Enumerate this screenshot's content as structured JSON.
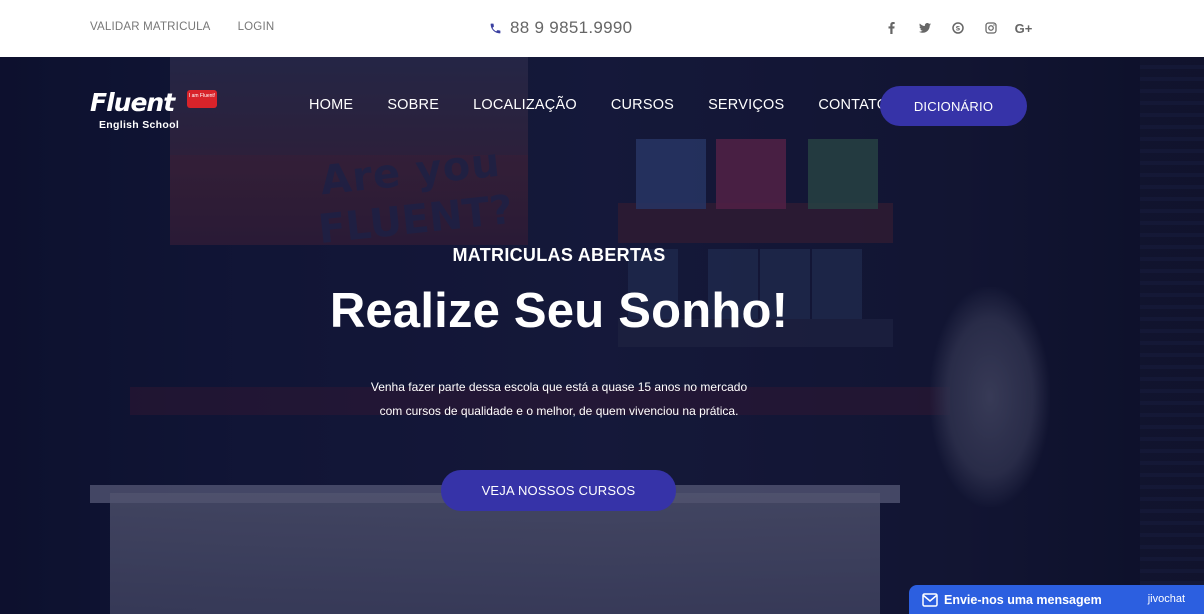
{
  "topbar": {
    "links": [
      "VALIDAR MATRICULA",
      "LOGIN"
    ],
    "phone": "88 9 9851.9990",
    "socials": [
      {
        "icon": "facebook-icon"
      },
      {
        "icon": "twitter-icon"
      },
      {
        "icon": "skype-icon"
      },
      {
        "icon": "instagram-icon"
      },
      {
        "icon": "google-plus-icon",
        "label": "G+"
      }
    ]
  },
  "logo": {
    "main": "Fluent",
    "tag": "I am Fluent!",
    "sub": "English School"
  },
  "nav": {
    "items": [
      "HOME",
      "SOBRE",
      "LOCALIZAÇÃO",
      "CURSOS",
      "SERVIÇOS",
      "CONTATO"
    ],
    "button": "DICIONÁRIO"
  },
  "hero": {
    "kicker": "MATRICULAS ABERTAS",
    "title": "Realize Seu Sonho!",
    "text_line1": "Venha fazer parte dessa escola que está a quase 15 anos no mercado",
    "text_line2": "com cursos de qualidade e o melhor, de quem vivenciou na prática.",
    "cta": "VEJA NOSSOS CURSOS",
    "poster_text_1": "Are you",
    "poster_text_2": "FLUENT?"
  },
  "chat": {
    "label": "Envie-nos uma mensagem",
    "brand": "jivochat"
  },
  "colors": {
    "accent": "#3633a8",
    "chat": "#2c5fe0",
    "logo_tag": "#d8232a"
  }
}
